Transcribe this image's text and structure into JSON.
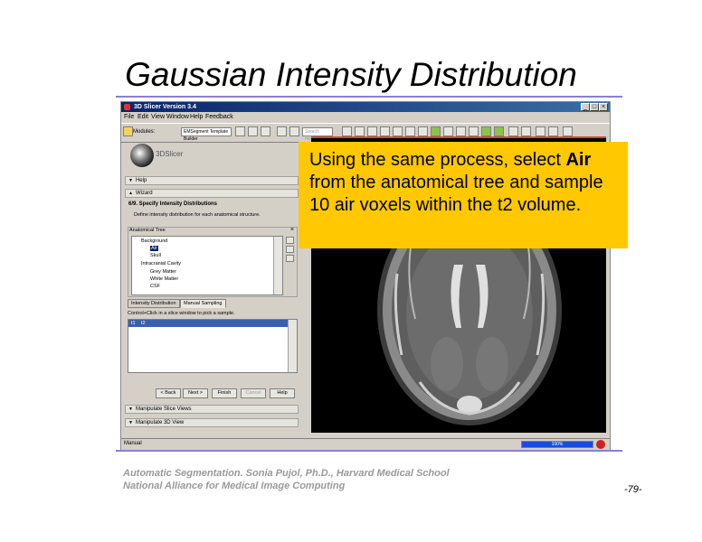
{
  "slide": {
    "title": "Gaussian Intensity Distribution",
    "footer_line1": "Automatic Segmentation. Sonia Pujol, Ph.D., Harvard Medical School",
    "footer_line2": "National Alliance for Medical Image Computing",
    "page_number": "-79-"
  },
  "callout": {
    "text_pre": "Using the same process, select ",
    "bold": "Air",
    "text_post": " from the anatomical tree and sample 10 air voxels within the t2 volume.",
    "color": "#ffc800"
  },
  "app": {
    "window_title": "3D Slicer Version 3.4",
    "menu": [
      "File",
      "Edit",
      "View",
      "Window",
      "Help",
      "Feedback"
    ],
    "modules_label": "Modules:",
    "module_selected": "EMSegment Template Builder",
    "search_placeholder": "Search modules",
    "logo_text": "3DSlicer",
    "sections": {
      "help": "Help",
      "wizard": "Wizard",
      "manipulate_slice": "Manipulate Slice Views",
      "manipulate_3d": "Manipulate 3D View"
    },
    "step": {
      "title": "6/9. Specify Intensity Distributions",
      "description": "Define intensity distribution for each anatomical structure."
    },
    "tree": {
      "header": "Anatomical Tree",
      "items": [
        "Background",
        "Air",
        "Skull",
        "Intracranial Cavity",
        "Grey Matter",
        "White Matter",
        "CSF"
      ],
      "selected": "Air"
    },
    "tabs": [
      "Intensity Distribution",
      "Manual Sampling"
    ],
    "active_tab": "Manual Sampling",
    "instruction": "Control+Click in a slice window to pick a sample.",
    "sample_columns": [
      "t1",
      "t2"
    ],
    "nav_buttons": {
      "back": "< Back",
      "next": "Next >",
      "finish": "Finish",
      "cancel": "Cancel",
      "help": "Help"
    },
    "status": "Manual",
    "progress": "100%",
    "accent": "#0a246a"
  }
}
